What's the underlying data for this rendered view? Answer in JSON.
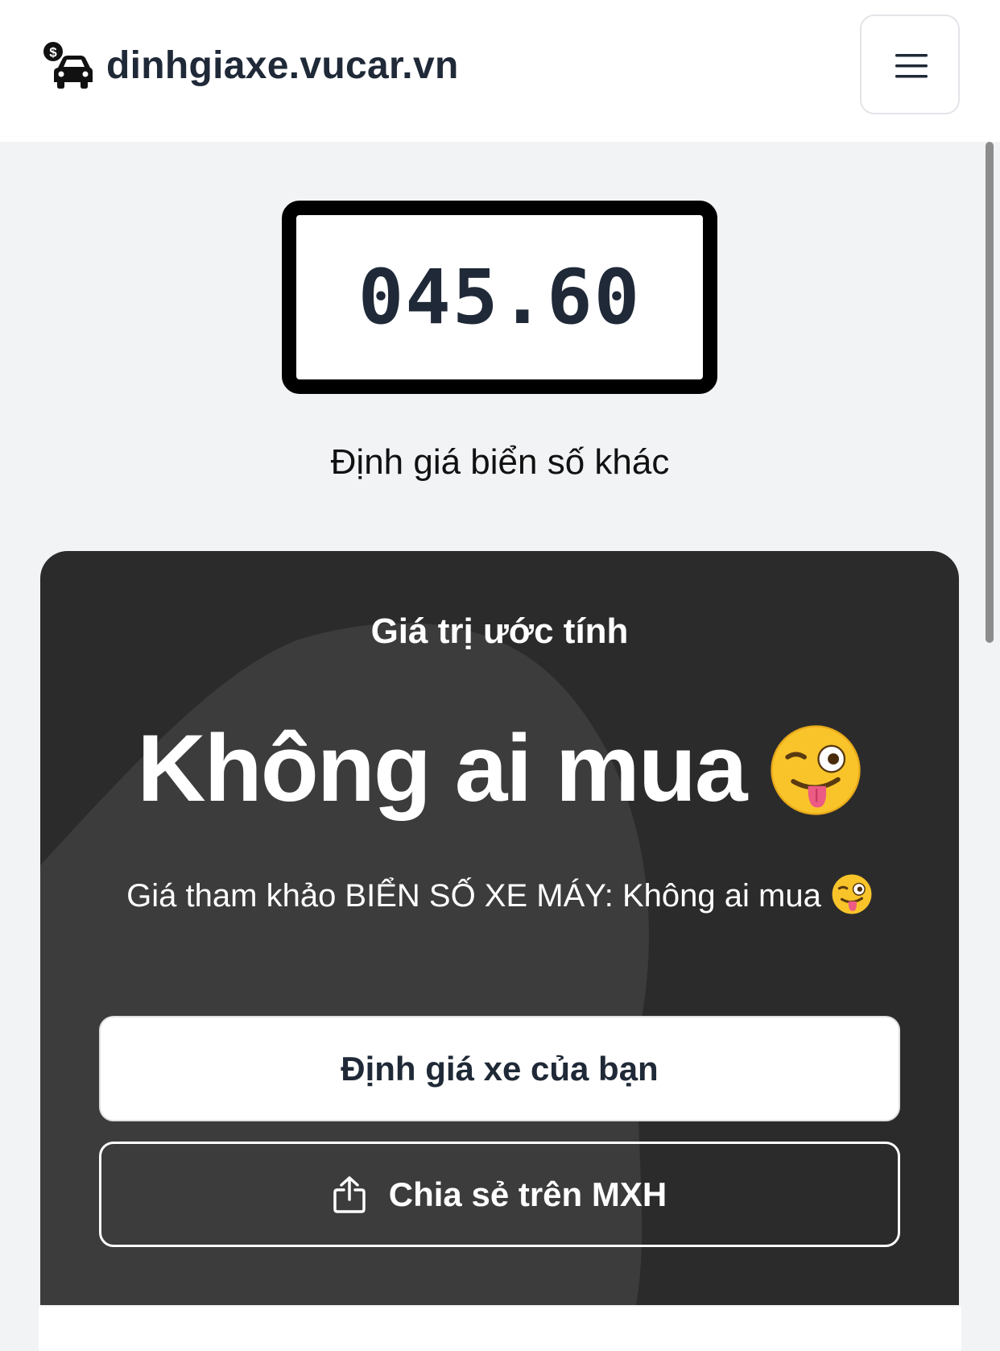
{
  "header": {
    "site_name": "dinhgiaxe.vucar.vn",
    "logo_icon": "car-price-icon",
    "menu_icon": "hamburger-menu-icon"
  },
  "plate": {
    "number": "045.60"
  },
  "other_plate_link": "Định giá biển số khác",
  "result_card": {
    "title": "Giá trị ước tính",
    "value": "Không ai mua",
    "value_emoji": "winking-face-with-tongue",
    "description": "Giá tham khảo BIỂN SỐ XE MÁY: Không ai mua",
    "primary_button": "Định giá xe của bạn",
    "share_button": "Chia sẻ trên MXH",
    "share_icon": "share-upload-icon"
  },
  "colors": {
    "card_bg": "#2b2b2b",
    "page_bg": "#f2f3f5",
    "text_dark": "#1f2937"
  }
}
